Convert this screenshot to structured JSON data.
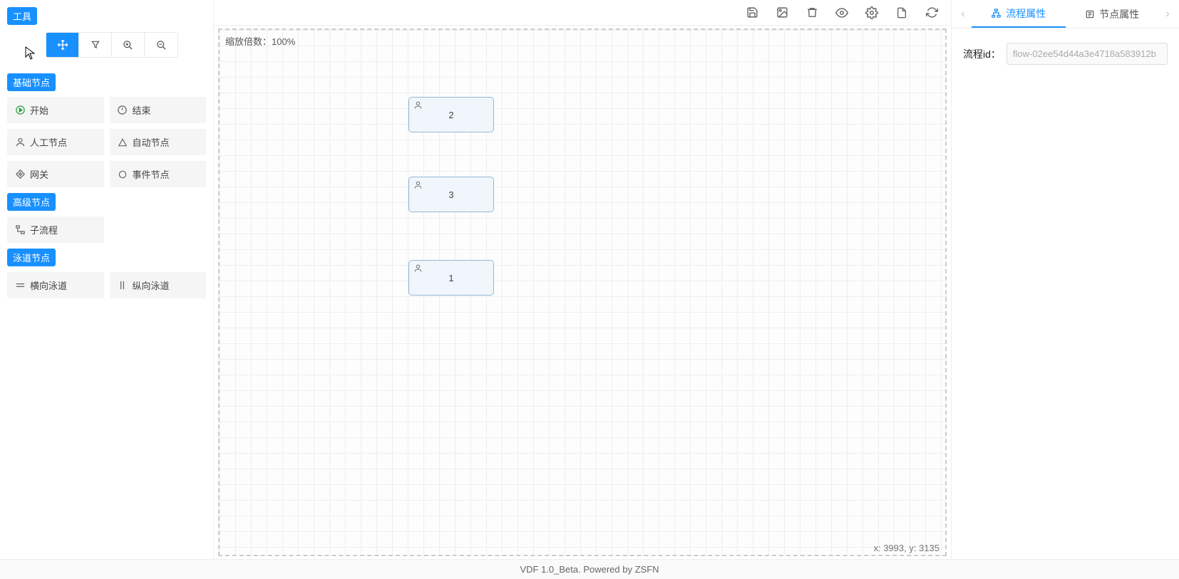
{
  "sidebar": {
    "tools_header": "工具",
    "section_basic": "基础节点",
    "section_advanced": "高级节点",
    "section_lane": "泳道节点",
    "basic_nodes": {
      "start": "开始",
      "end": "结束",
      "human": "人工节点",
      "auto": "自动节点",
      "gateway": "网关",
      "event": "事件节点"
    },
    "advanced_nodes": {
      "subflow": "子流程"
    },
    "lane_nodes": {
      "hlane": "横向泳道",
      "vlane": "纵向泳道"
    }
  },
  "canvas": {
    "zoom_label_prefix": "缩放倍数：",
    "zoom_value": "100%",
    "coords_prefix_x": "x: ",
    "coords_x": "3993",
    "coords_sep": ", y: ",
    "coords_y": "3135",
    "nodes": {
      "n1": "2",
      "n2": "3",
      "n3": "1"
    }
  },
  "right": {
    "tab_flow": "流程属性",
    "tab_node": "节点属性",
    "flow_id_label": "流程id：",
    "flow_id_value": "flow-02ee54d44a3e4718a583912b"
  },
  "footer": {
    "text": "VDF 1.0_Beta. Powered by ZSFN"
  }
}
